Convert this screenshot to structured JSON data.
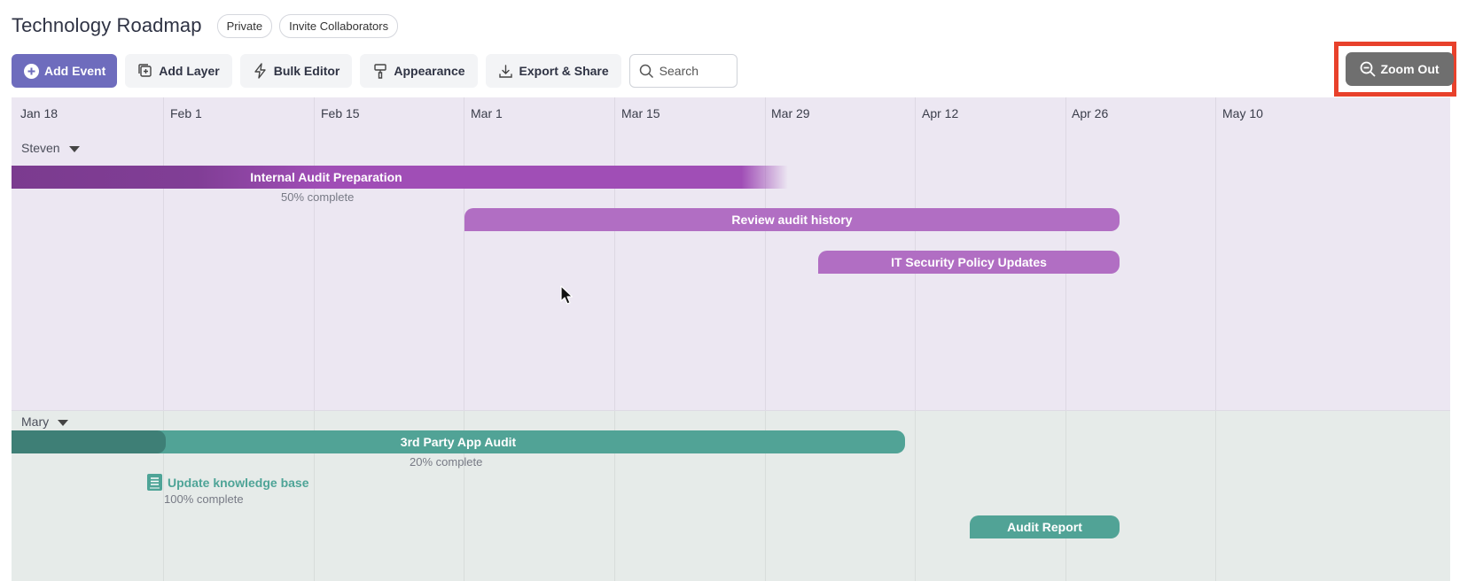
{
  "header": {
    "title": "Technology Roadmap",
    "privacy_pill": "Private",
    "invite_pill": "Invite Collaborators"
  },
  "toolbar": {
    "add_event": "Add Event",
    "add_layer": "Add Layer",
    "bulk_editor": "Bulk Editor",
    "appearance": "Appearance",
    "export_share": "Export & Share",
    "search_placeholder": "Search",
    "zoom_out": "Zoom Out"
  },
  "colors": {
    "primary": "#6e6cbd",
    "highlight": "#e8412b",
    "purple": "#a04eb6",
    "purple_light": "#b16ec3",
    "teal": "#51a396"
  },
  "timeline": {
    "dates": [
      "Jan 18",
      "Feb 1",
      "Feb 15",
      "Mar 1",
      "Mar 15",
      "Mar 29",
      "Apr 12",
      "Apr 26",
      "May 10"
    ],
    "lanes": [
      {
        "name": "Steven",
        "events": [
          {
            "title": "Internal Audit Preparation",
            "progress_label": "50% complete",
            "progress": 0.5
          },
          {
            "title": "Review audit history"
          },
          {
            "title": "IT Security Policy Updates"
          }
        ]
      },
      {
        "name": "Mary",
        "events": [
          {
            "title": "3rd Party App Audit",
            "progress_label": "20% complete",
            "progress": 0.2
          },
          {
            "title": "Update knowledge base",
            "progress_label": "100% complete",
            "progress": 1.0,
            "icon": "book-icon"
          },
          {
            "title": "Audit Report"
          }
        ]
      }
    ]
  }
}
